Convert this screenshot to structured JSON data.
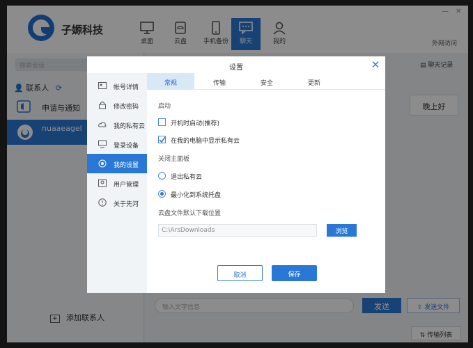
{
  "brand": {
    "name": "子嫄科技"
  },
  "nav": [
    {
      "label": "桌面",
      "icon": "monitor-icon"
    },
    {
      "label": "云盘",
      "icon": "cloud-drive-icon"
    },
    {
      "label": "手机备份",
      "icon": "phone-icon"
    },
    {
      "label": "聊天",
      "icon": "chat-icon",
      "active": true
    },
    {
      "label": "我的",
      "icon": "user-icon"
    }
  ],
  "header": {
    "outside_access": "外网访问"
  },
  "left": {
    "search_placeholder": "搜索会话",
    "contacts_tab": "联系人",
    "contacts": [
      {
        "name": "申请与通知",
        "icon": "notification-icon"
      },
      {
        "name": "nuaaeagel",
        "icon": "avatar-icon",
        "selected": true
      }
    ],
    "add_contact": "添加联系人"
  },
  "chat": {
    "history": "聊天记录",
    "bubble_text": "晚上好",
    "input_placeholder": "输入文字信息",
    "send": "发送",
    "send_file": "发送文件",
    "transfer_list": "传输列表"
  },
  "dialog": {
    "title": "设置",
    "menu": [
      {
        "label": "帐号详情",
        "icon": "account-icon"
      },
      {
        "label": "修改密码",
        "icon": "lock-icon"
      },
      {
        "label": "我的私有云",
        "icon": "cloud-icon"
      },
      {
        "label": "登录设备",
        "icon": "device-icon"
      },
      {
        "label": "我的设置",
        "icon": "settings-icon",
        "active": true
      },
      {
        "label": "用户管理",
        "icon": "users-icon"
      },
      {
        "label": "关于先河",
        "icon": "info-icon"
      }
    ],
    "tabs": [
      {
        "label": "常规",
        "active": true
      },
      {
        "label": "传输"
      },
      {
        "label": "安全"
      },
      {
        "label": "更新"
      }
    ],
    "startup_section": "启动",
    "startup_options": [
      {
        "label": "开机时启动(推荐)",
        "checked": false
      },
      {
        "label": "在我的电脑中显示私有云",
        "checked": true
      }
    ],
    "close_section": "关闭主面板",
    "close_options": [
      {
        "label": "退出私有云",
        "selected": false
      },
      {
        "label": "最小化到系统托盘",
        "selected": true
      }
    ],
    "download_section": "云盘文件默认下载位置",
    "download_path": "C:\\ArsDownloads",
    "browse": "浏览",
    "cancel": "取消",
    "save": "保存"
  },
  "colors": {
    "accent": "#2a78d6",
    "overlay": "#000000"
  }
}
